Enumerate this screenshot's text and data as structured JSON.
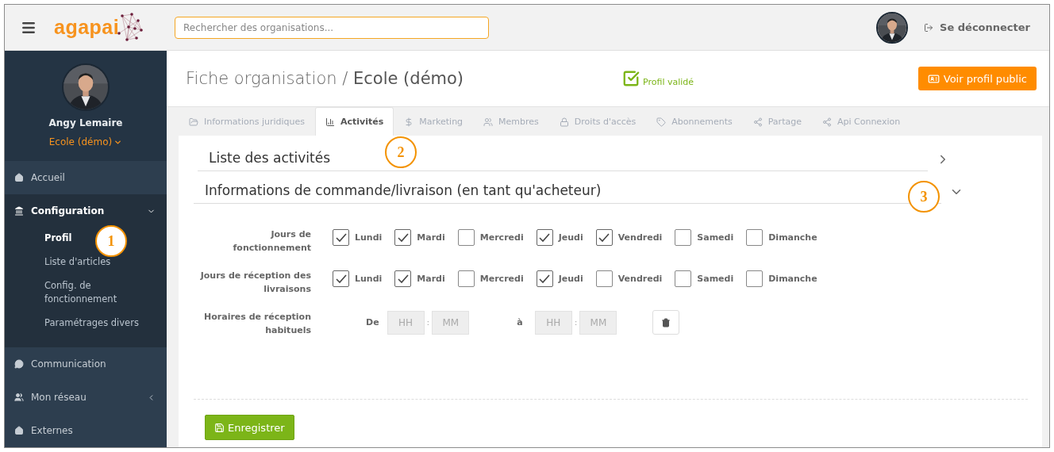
{
  "header": {
    "logo": "agapai",
    "search": {
      "placeholder": "Rechercher des organisations..."
    },
    "logout": "Se déconnecter"
  },
  "sidebar": {
    "user": "Angy Lemaire",
    "organisation": "Ecole (démo)",
    "items": [
      {
        "label": "Accueil",
        "expanded": false
      },
      {
        "label": "Configuration",
        "expanded": true,
        "children": [
          {
            "label": "Profil",
            "selected": true
          },
          {
            "label": "Liste d'articles",
            "selected": false
          },
          {
            "label": "Config. de fonctionnement",
            "selected": false
          },
          {
            "label": "Paramétrages divers",
            "selected": false
          }
        ]
      },
      {
        "label": "Communication",
        "expanded": false
      },
      {
        "label": "Mon réseau",
        "expanded": false,
        "has_children": true
      },
      {
        "label": "Externes",
        "expanded": false
      }
    ]
  },
  "page": {
    "title": "Fiche organisation / **Ecole (démo)**",
    "status": "Profil validé",
    "public_button": "Voir profil public"
  },
  "tabs": [
    {
      "label": "Informations juridiques",
      "selected": false
    },
    {
      "label": "Activités",
      "selected": true
    },
    {
      "label": "Marketing",
      "selected": false
    },
    {
      "label": "Membres",
      "selected": false
    },
    {
      "label": "Droits d'accès",
      "selected": false
    },
    {
      "label": "Abonnements",
      "selected": false
    },
    {
      "label": "Partage",
      "selected": false
    },
    {
      "label": "Api Connexion",
      "selected": false
    }
  ],
  "sections": [
    {
      "title": "Liste des activités",
      "expanded": false
    },
    {
      "title": "Informations de commande/livraison (en tant qu'acheteur)",
      "expanded": true
    }
  ],
  "form": [
    {
      "kind": "days",
      "label": "Jours de fonctionnement",
      "days": [
        {
          "label": "Lundi",
          "checked": true
        },
        {
          "label": "Mardi",
          "checked": true
        },
        {
          "label": "Mercredi",
          "checked": false
        },
        {
          "label": "Jeudi",
          "checked": true
        },
        {
          "label": "Vendredi",
          "checked": true
        },
        {
          "label": "Samedi",
          "checked": false
        },
        {
          "label": "Dimanche",
          "checked": false
        }
      ]
    },
    {
      "kind": "days",
      "label": "Jours de réception des livraisons",
      "days": [
        {
          "label": "Lundi",
          "checked": true
        },
        {
          "label": "Mardi",
          "checked": true
        },
        {
          "label": "Mercredi",
          "checked": false
        },
        {
          "label": "Jeudi",
          "checked": true
        },
        {
          "label": "Vendredi",
          "checked": false
        },
        {
          "label": "Samedi",
          "checked": false
        },
        {
          "label": "Dimanche",
          "checked": false
        }
      ]
    },
    {
      "kind": "time",
      "label": "Horaires de réception habituels",
      "ranges": [
        {
          "label": "De",
          "hour_placeholder": "HH",
          "separator": ":",
          "minute_placeholder": "MM"
        },
        {
          "label": "à",
          "hour_placeholder": "HH",
          "separator": ":",
          "minute_placeholder": "MM"
        }
      ]
    }
  ],
  "save_button": "Enregistrer",
  "markers": [
    "1",
    "2",
    "3"
  ]
}
